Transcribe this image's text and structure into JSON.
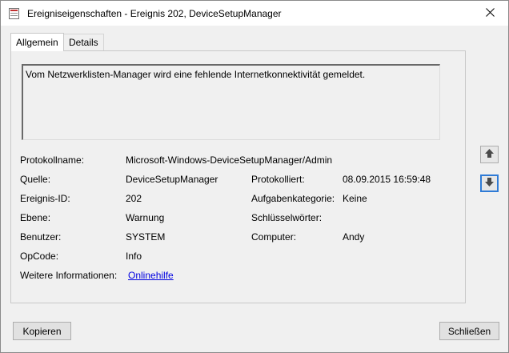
{
  "window": {
    "title": "Ereigniseigenschaften - Ereignis 202, DeviceSetupManager"
  },
  "tabs": [
    {
      "label": "Allgemein"
    },
    {
      "label": "Details"
    }
  ],
  "general": {
    "description": "Vom Netzwerklisten-Manager wird eine fehlende Internetkonnektivität gemeldet.",
    "log_name_label": "Protokollname:",
    "log_name": "Microsoft-Windows-DeviceSetupManager/Admin",
    "source_label": "Quelle:",
    "source": "DeviceSetupManager",
    "logged_label": "Protokolliert:",
    "logged": "08.09.2015 16:59:48",
    "event_id_label": "Ereignis-ID:",
    "event_id": "202",
    "task_category_label": "Aufgabenkategorie:",
    "task_category": "Keine",
    "level_label": "Ebene:",
    "level": "Warnung",
    "keywords_label": "Schlüsselwörter:",
    "keywords": "",
    "user_label": "Benutzer:",
    "user": "SYSTEM",
    "computer_label": "Computer:",
    "computer": "Andy",
    "opcode_label": "OpCode:",
    "opcode": "Info",
    "more_info_label": "Weitere Informationen:",
    "more_info_link": "Onlinehilfe"
  },
  "nav": {
    "up_icon": "arrow-up-icon",
    "down_icon": "arrow-down-icon"
  },
  "buttons": {
    "copy": "Kopieren",
    "close": "Schließen"
  }
}
